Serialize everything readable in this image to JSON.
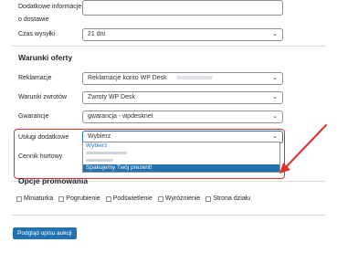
{
  "fields": {
    "dodatkowe_label_line1": "Dodatkowe informacje",
    "dodatkowe_label_line2": "o dostawie",
    "czas_wysylki_label": "Czas wysyłki",
    "czas_wysylki_value": "21 dni"
  },
  "warunki": {
    "title": "Warunki oferty",
    "reklamacje_label": "Reklamacje",
    "reklamacje_value": "Reklamacje konto WP Desk",
    "zwroty_label": "Warunki zwrotów",
    "zwroty_value": "Zwroty WP Desk",
    "gwarancje_label": "Gwarancje",
    "gwarancje_value": "gwarancja - wpdesknet",
    "uslugi_label": "Usługi dodatkowe",
    "uslugi_value": "Wybierz",
    "cennik_label": "Cennik hurtowy"
  },
  "dropdown": {
    "options": [
      "Wybierz",
      "Spakujemy Twój prezent!"
    ]
  },
  "promo": {
    "title": "Opcje promowania",
    "options": [
      "Miniaturka",
      "Pogrubienie",
      "Podświetlenie",
      "Wyróżnienie",
      "Strona działu"
    ]
  },
  "preview_button": "Podgląd opisu aukcji",
  "colors": {
    "accent": "#2271b1",
    "annotation": "#e0312b"
  }
}
